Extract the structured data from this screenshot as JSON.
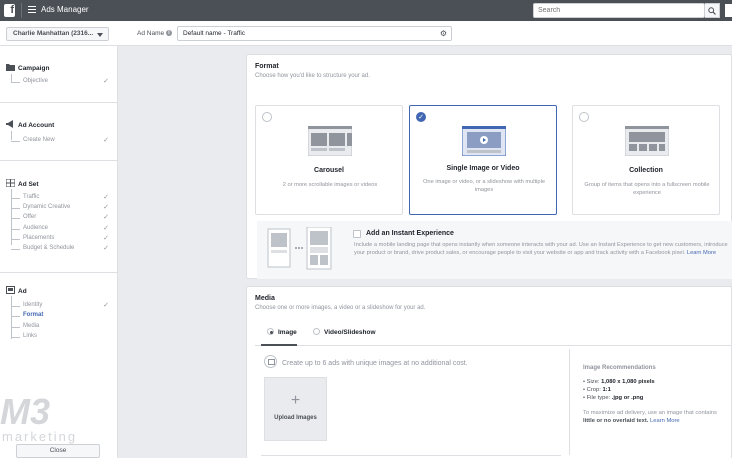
{
  "topbar": {
    "logo": "f",
    "title": "Ads Manager",
    "search_placeholder": "Search",
    "search_icon": "search-icon"
  },
  "subheader": {
    "account_name": "Charlie Manhattan (2316...",
    "ad_name_label": "Ad Name",
    "ad_name_value": "Default name - Traffic"
  },
  "sidebar": {
    "campaign": {
      "label": "Campaign",
      "items": [
        {
          "label": "Objective",
          "done": true
        }
      ]
    },
    "ad_account": {
      "label": "Ad Account",
      "items": [
        {
          "label": "Create New",
          "done": true
        }
      ]
    },
    "ad_set": {
      "label": "Ad Set",
      "items": [
        {
          "label": "Traffic",
          "done": true
        },
        {
          "label": "Dynamic Creative",
          "done": true
        },
        {
          "label": "Offer",
          "done": true
        },
        {
          "label": "Audience",
          "done": true
        },
        {
          "label": "Placements",
          "done": true
        },
        {
          "label": "Budget & Schedule",
          "done": true
        }
      ]
    },
    "ad": {
      "label": "Ad",
      "items": [
        {
          "label": "Identity",
          "done": true
        },
        {
          "label": "Format",
          "active": true
        },
        {
          "label": "Media"
        },
        {
          "label": "Links"
        }
      ]
    },
    "close_label": "Close",
    "watermark_text": "M3 marketing"
  },
  "format": {
    "title": "Format",
    "subtitle": "Choose how you'd like to structure your ad.",
    "options": [
      {
        "title": "Carousel",
        "desc": "2 or more scrollable images or videos",
        "selected": false
      },
      {
        "title": "Single Image or Video",
        "desc": "One image or video, or a slideshow with multiple images",
        "selected": true
      },
      {
        "title": "Collection",
        "desc": "Group of items that opens into a fullscreen mobile experience",
        "selected": false
      }
    ],
    "instant": {
      "title": "Add an Instant Experience",
      "desc": "Include a mobile landing page that opens instantly when someone interacts with your ad. Use an Instant Experience to get new customers, introduce your product or brand, drive product sales, or encourage people to visit your website or app and track activity with a Facebook pixel.",
      "link": "Learn More"
    }
  },
  "media": {
    "title": "Media",
    "subtitle": "Choose one or more images, a video or a slideshow for your ad.",
    "tabs": [
      {
        "label": "Image",
        "selected": true
      },
      {
        "label": "Video/Slideshow",
        "selected": false
      }
    ],
    "create_text": "Create up to 6 ads with unique images at no additional cost.",
    "upload_label": "Upload Images",
    "recs": {
      "title": "Image Recommendations",
      "size_label": "Size:",
      "size_value": "1,080 x 1,080 pixels",
      "crop_label": "Crop:",
      "crop_value": "1:1",
      "type_label": "File type:",
      "type_value": ".jpg or .png",
      "note_pre": "To maximize ad delivery, use an image that contains",
      "note_bold": "little or no overlaid text.",
      "note_link": "Learn More"
    }
  },
  "colors": {
    "accent": "#4267b2",
    "topbar": "#4b4f56",
    "background": "#e9ebee"
  }
}
